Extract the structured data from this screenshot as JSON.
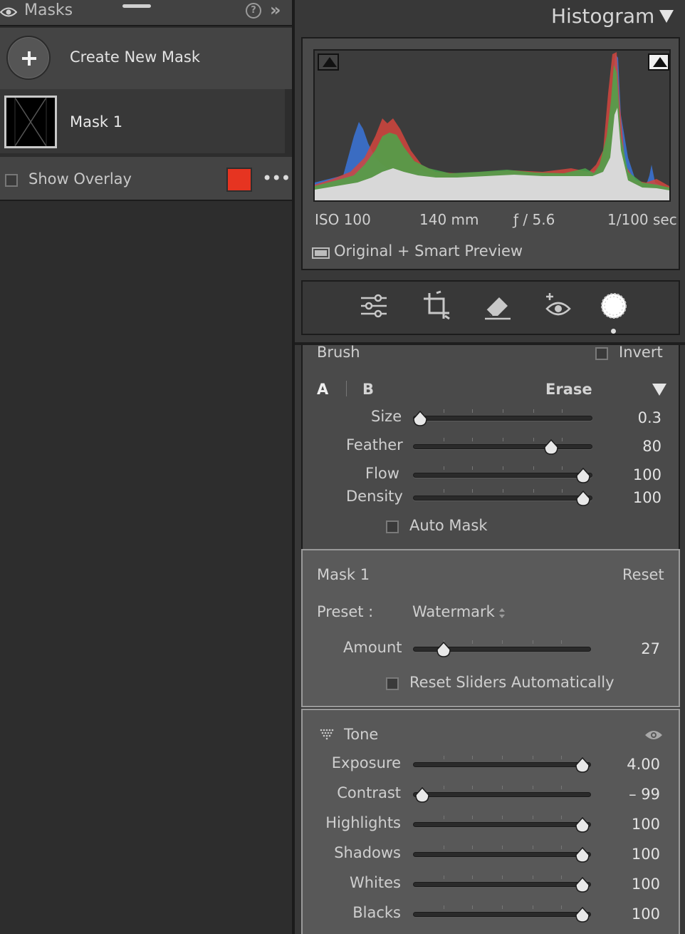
{
  "masks_panel": {
    "title": "Masks",
    "help_glyph": "?",
    "collapse_glyph": "»",
    "create_label": "Create New Mask",
    "mask_item_label": "Mask 1",
    "show_overlay_label": "Show Overlay",
    "overlay_color": "#e63421",
    "more_glyph": "•••"
  },
  "histogram": {
    "title": "Histogram",
    "iso": "ISO 100",
    "focal": "140 mm",
    "aperture": "ƒ / 5.6",
    "shutter": "1/100 sec",
    "preview": "Original + Smart Preview"
  },
  "tools": [
    "sliders-icon",
    "crop-icon",
    "eraser-icon",
    "redeye-icon",
    "mask-icon"
  ],
  "brush": {
    "title": "Brush",
    "invert_label": "Invert",
    "tab_a": "A",
    "tab_b": "B",
    "erase_label": "Erase",
    "size_label": "Size",
    "size_value": "0.3",
    "size_pos": 0.04,
    "feather_label": "Feather",
    "feather_value": "80",
    "feather_pos": 0.77,
    "flow_label": "Flow",
    "flow_value": "100",
    "flow_pos": 0.95,
    "density_label": "Density",
    "density_value": "100",
    "density_pos": 0.95,
    "auto_mask_label": "Auto Mask"
  },
  "mask_settings": {
    "title": "Mask 1",
    "reset_label": "Reset",
    "preset_label": "Preset :",
    "preset_value": "Watermark",
    "amount_label": "Amount",
    "amount_value": "27",
    "amount_pos": 0.17,
    "reset_auto_label": "Reset Sliders Automatically"
  },
  "tone": {
    "title": "Tone",
    "rows": [
      {
        "label": "Exposure",
        "value": "4.00",
        "pos": 0.95
      },
      {
        "label": "Contrast",
        "value": "– 99",
        "pos": 0.05
      },
      {
        "label": "Highlights",
        "value": "100",
        "pos": 0.95
      },
      {
        "label": "Shadows",
        "value": "100",
        "pos": 0.95
      },
      {
        "label": "Whites",
        "value": "100",
        "pos": 0.95
      },
      {
        "label": "Blacks",
        "value": "100",
        "pos": 0.95
      }
    ]
  }
}
